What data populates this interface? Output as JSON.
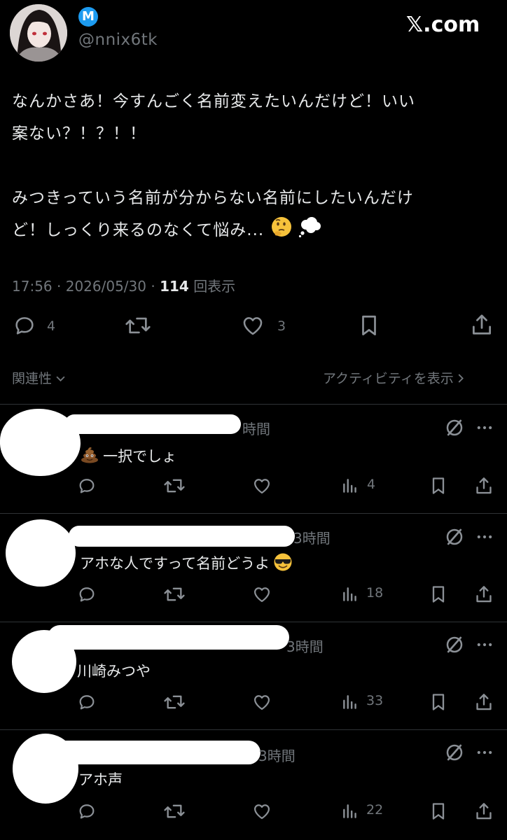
{
  "header": {
    "badge_letter": "M",
    "handle": "@nnix6tk",
    "site": "𝕏.com"
  },
  "post": {
    "lines": [
      "なんかさあ！今すんごく名前変えたいんだけど！いい",
      "案ない？！？！！",
      "みつきっていう名前が分からない名前にしたいんだけ",
      "ど！しっくり来るのなくて悩み..."
    ],
    "emoji": [
      "thinking-face",
      "thought-balloon"
    ],
    "time": "17:56",
    "date": "2026/05/30",
    "views_count": "114",
    "views_label": "回表示",
    "reply_count": "4",
    "like_count": "3"
  },
  "controls": {
    "sort_label": "関連性",
    "activity_label": "アクティビティを表示"
  },
  "replies": [
    {
      "time_fragment": "時間",
      "text": "一択でしょ",
      "emoji": "pile-of-poo",
      "views": "4"
    },
    {
      "time_fragment": "3時間",
      "text": "アホな人ですって名前どうよ",
      "emoji": "smiling-face-with-sunglasses",
      "views": "18"
    },
    {
      "time_fragment": "3時間",
      "text": "川崎みつや",
      "emoji": "",
      "views": "33"
    },
    {
      "time_fragment": "3時間",
      "text": "アホ声",
      "emoji": "",
      "views": "22"
    }
  ],
  "colors": {
    "background": "#000000",
    "text": "#e7e9ea",
    "secondary": "#71767b",
    "badge": "#1d9bf0",
    "divider": "#2f3336"
  }
}
